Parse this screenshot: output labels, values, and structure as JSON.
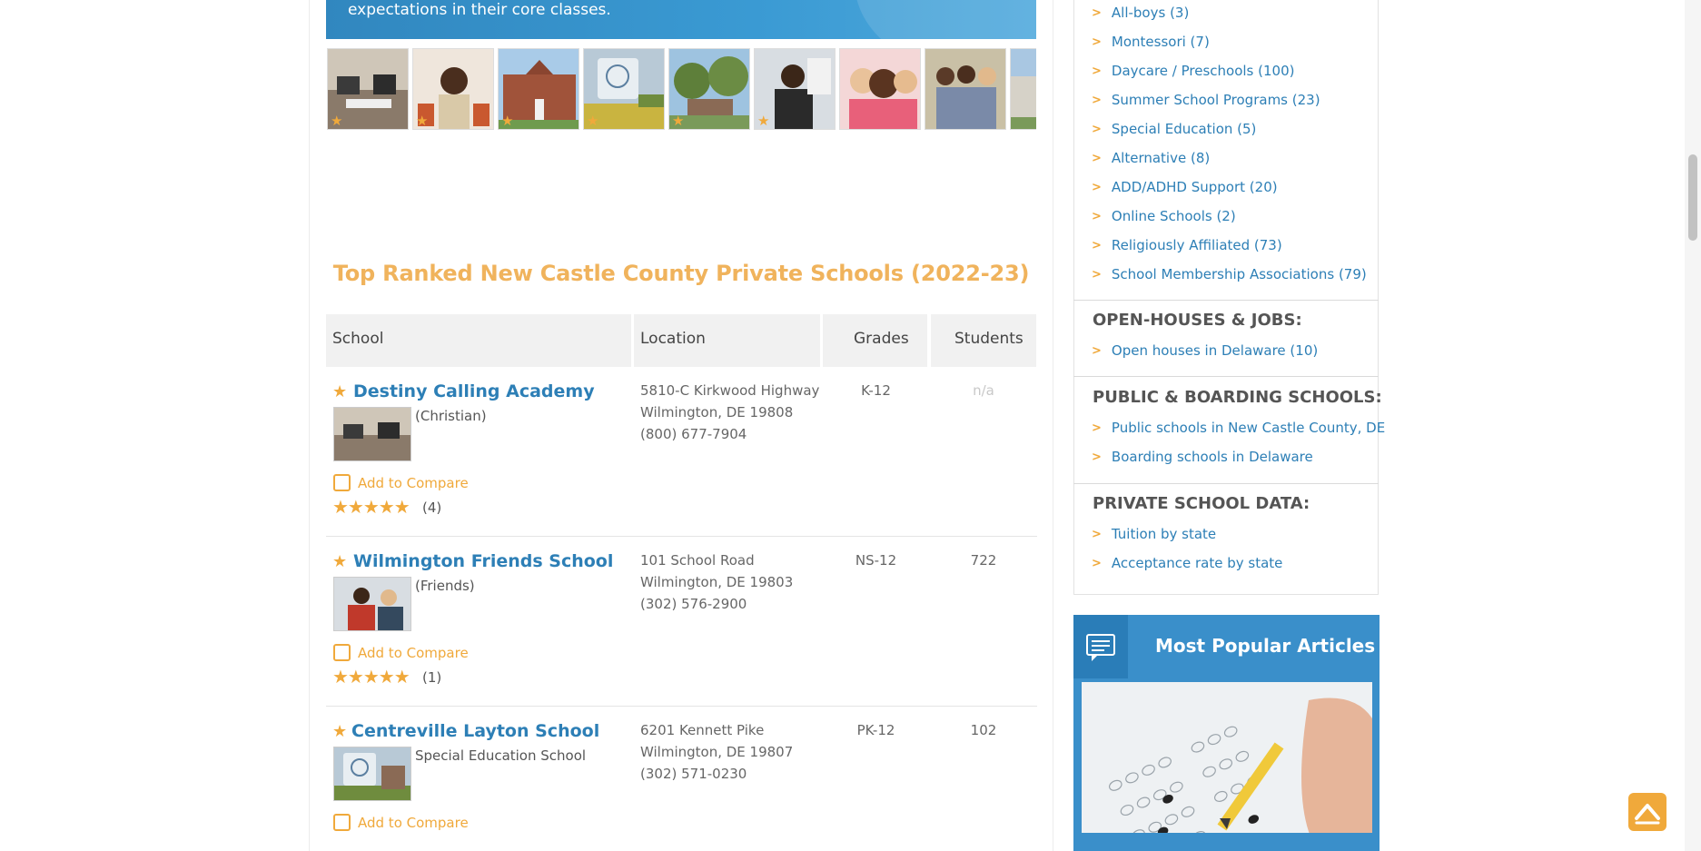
{
  "banner": {
    "text": "expectations in their core classes."
  },
  "gallery": {
    "thumbnails": [
      {
        "alt": "classroom",
        "starred": true
      },
      {
        "alt": "child",
        "starred": true
      },
      {
        "alt": "school building",
        "starred": true
      },
      {
        "alt": "school sign",
        "starred": true
      },
      {
        "alt": "campus trees",
        "starred": true
      },
      {
        "alt": "student",
        "starred": true
      },
      {
        "alt": "kids smiling",
        "starred": false
      },
      {
        "alt": "students outside",
        "starred": false
      },
      {
        "alt": "building",
        "starred": false
      }
    ]
  },
  "section": {
    "title": "Top Ranked New Castle County Private Schools (2022-23)"
  },
  "table": {
    "headers": {
      "school": "School",
      "location": "Location",
      "grades": "Grades",
      "students": "Students"
    },
    "rows": [
      {
        "name": "Destiny Calling Academy",
        "type": "(Christian)",
        "compare": "Add to Compare",
        "stars": "★★★★★",
        "rating_count": "(4)",
        "address1": "5810-C Kirkwood Highway",
        "address2": "Wilmington, DE 19808",
        "phone": "(800) 677-7904",
        "grades": "K-12",
        "students": "n/a"
      },
      {
        "name": "Wilmington Friends School",
        "type": "(Friends)",
        "compare": "Add to Compare",
        "stars": "★★★★★",
        "rating_count": "(1)",
        "address1": "101 School Road",
        "address2": "Wilmington, DE 19803",
        "phone": "(302) 576-2900",
        "grades": "NS-12",
        "students": "722"
      },
      {
        "name": "Centreville Layton School",
        "type": "Special Education School",
        "compare": "Add to Compare",
        "address1": "6201 Kennett Pike",
        "address2": "Wilmington, DE 19807",
        "phone": "(302) 571-0230",
        "grades": "PK-12",
        "students": "102"
      }
    ]
  },
  "sidebar": {
    "type_links": [
      "All-boys (3)",
      "Montessori (7)",
      "Daycare / Preschools (100)",
      "Summer School Programs (23)",
      "Special Education (5)",
      "Alternative (8)",
      "ADD/ADHD Support (20)",
      "Online Schools (2)",
      "Religiously Affiliated (73)",
      "School Membership Associations (79)"
    ],
    "open_houses": {
      "heading": "OPEN-HOUSES & JOBS:",
      "links": [
        "Open houses in Delaware (10)"
      ]
    },
    "public_boarding": {
      "heading": "PUBLIC & BOARDING SCHOOLS:",
      "links": [
        "Public schools in New Castle County, DE",
        "Boarding schools in Delaware"
      ]
    },
    "private_data": {
      "heading": "PRIVATE SCHOOL DATA:",
      "links": [
        "Tuition by state",
        "Acceptance rate by state"
      ]
    }
  },
  "popular": {
    "title": "Most Popular Articles"
  },
  "colors": {
    "link": "#2d7fb6",
    "accent": "#f0a93b",
    "heading_orange": "#f0b35c",
    "banner_blue": "#3a8fca"
  }
}
